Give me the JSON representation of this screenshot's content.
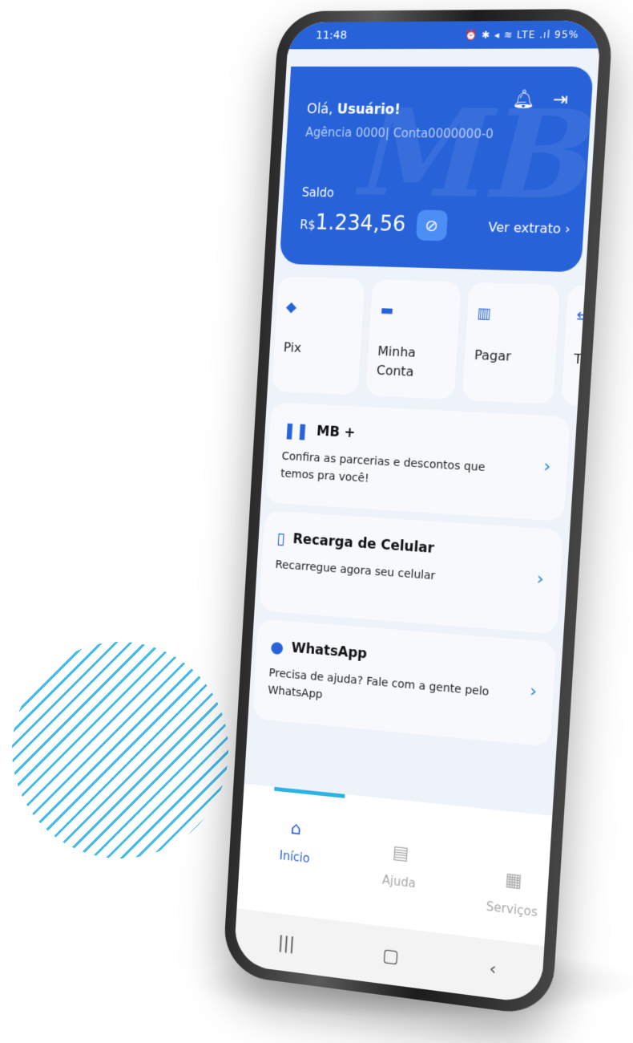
{
  "status_bar": {
    "time": "11:48",
    "icons": "⏰ ✱ ◂ ≋ LTE .ıl 95%"
  },
  "account_card": {
    "greeting_prefix": "Olá, ",
    "greeting_name": "Usuário!",
    "account_info": "Agência 0000| Conta0000000-0",
    "balance_label": "Saldo",
    "currency": "R$",
    "balance": "1.234,56",
    "statement_link": "Ver extrato",
    "watermark": "MB"
  },
  "quick_actions": [
    {
      "label": "Pix",
      "icon": "pix-icon"
    },
    {
      "label": "Minha Conta",
      "icon": "wallet-icon"
    },
    {
      "label": "Pagar",
      "icon": "barcode-icon"
    },
    {
      "label": "Transferir",
      "icon": "transfer-icon"
    }
  ],
  "cards": [
    {
      "title": "MB +",
      "description": "Confira as parcerias e descontos que temos pra você!",
      "icon": "tag-icon"
    },
    {
      "title": "Recarga de Celular",
      "description": "Recarregue agora seu celular",
      "icon": "phone-recharge-icon"
    },
    {
      "title": "WhatsApp",
      "description": "Precisa de ajuda? Fale com a gente pelo WhatsApp",
      "icon": "whatsapp-icon"
    }
  ],
  "bottom_nav": [
    {
      "label": "Início",
      "icon": "home-icon",
      "active": true
    },
    {
      "label": "Ajuda",
      "icon": "help-doc-icon",
      "active": false
    },
    {
      "label": "Serviços",
      "icon": "grid-icon",
      "active": false
    }
  ],
  "colors": {
    "primary": "#2762d8",
    "accent": "#2bb4e2",
    "background": "#eef2f9"
  }
}
